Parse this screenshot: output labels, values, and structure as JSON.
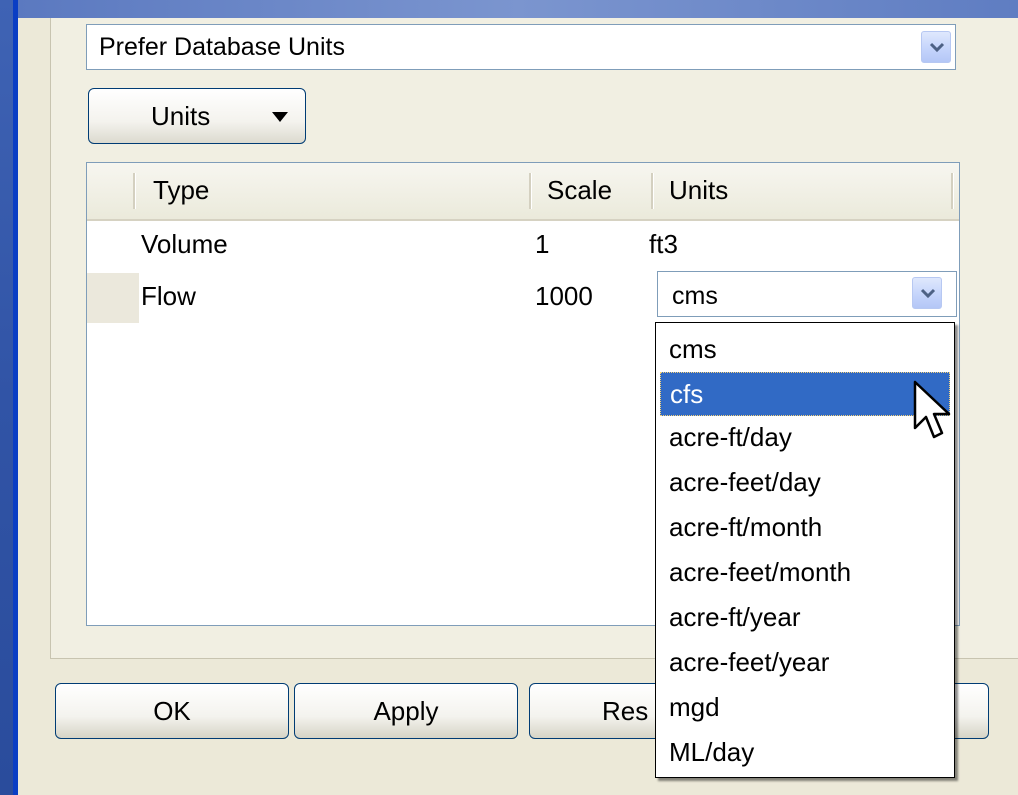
{
  "prefer_combo": {
    "value": "Prefer Database Units",
    "icon": "chevron-down-icon"
  },
  "units_button": {
    "label": "Units",
    "icon": "triangle-down-icon"
  },
  "list": {
    "columns": [
      "Type",
      "Scale",
      "Units"
    ],
    "rows": [
      {
        "type": "Volume",
        "scale": "1",
        "units": "ft3"
      },
      {
        "type": "Flow",
        "scale": "1000",
        "units": "cms"
      }
    ]
  },
  "units_dropdown": {
    "selected": "cfs",
    "options": [
      "cms",
      "cfs",
      "acre-ft/day",
      "acre-feet/day",
      "acre-ft/month",
      "acre-feet/month",
      "acre-ft/year",
      "acre-feet/year",
      "mgd",
      "ML/day"
    ]
  },
  "buttons": {
    "ok": "OK",
    "apply": "Apply",
    "reset_partial": "Res"
  },
  "colors": {
    "selection": "#316ac5",
    "border": "#7f9db9",
    "button_border": "#003c74",
    "desktop_blue": "#3154a6"
  }
}
